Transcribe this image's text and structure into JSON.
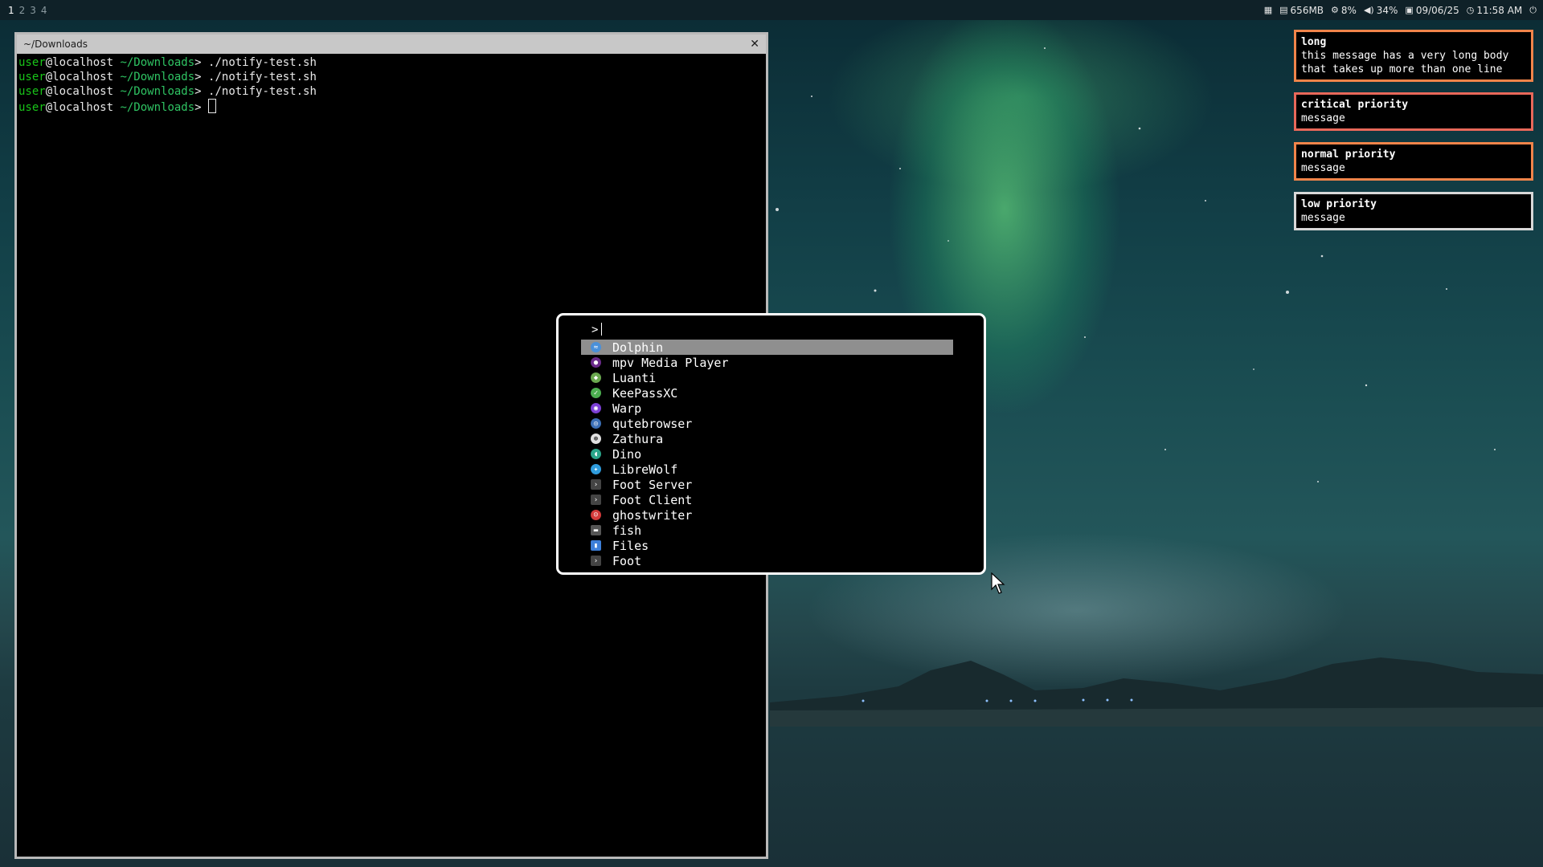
{
  "topbar": {
    "workspaces": [
      "1",
      "2",
      "3",
      "4"
    ],
    "active_workspace": "1",
    "memory": "656MB",
    "cpu": "8%",
    "volume": "34%",
    "date": "09/06/25",
    "time": "11:58 AM"
  },
  "terminal": {
    "title": "~/Downloads",
    "lines": [
      {
        "user": "user",
        "host": "@localhost",
        "path": " ~/Downloads",
        "cmd": "> ./notify-test.sh"
      },
      {
        "user": "user",
        "host": "@localhost",
        "path": " ~/Downloads",
        "cmd": "> ./notify-test.sh"
      },
      {
        "user": "user",
        "host": "@localhost",
        "path": " ~/Downloads",
        "cmd": "> ./notify-test.sh"
      },
      {
        "user": "user",
        "host": "@localhost",
        "path": " ~/Downloads",
        "cmd": "> "
      }
    ]
  },
  "launcher": {
    "prompt": ">",
    "apps": [
      {
        "label": "Dolphin",
        "icon": "dolphin-icon",
        "color": "#4a90d9"
      },
      {
        "label": "mpv Media Player",
        "icon": "mpv-icon",
        "color": "#6a2a8a"
      },
      {
        "label": "Luanti",
        "icon": "luanti-icon",
        "color": "#6aa84f"
      },
      {
        "label": "KeePassXC",
        "icon": "keepassxc-icon",
        "color": "#4caf50"
      },
      {
        "label": "Warp",
        "icon": "warp-icon",
        "color": "#7b3fd4"
      },
      {
        "label": "qutebrowser",
        "icon": "qutebrowser-icon",
        "color": "#3b6fb6"
      },
      {
        "label": "Zathura",
        "icon": "zathura-icon",
        "color": "#e0e0e0"
      },
      {
        "label": "Dino",
        "icon": "dino-icon",
        "color": "#2aa58a"
      },
      {
        "label": "LibreWolf",
        "icon": "librewolf-icon",
        "color": "#2f9cdc"
      },
      {
        "label": "Foot Server",
        "icon": "terminal-icon",
        "color": "#444444"
      },
      {
        "label": "Foot Client",
        "icon": "terminal-icon",
        "color": "#444444"
      },
      {
        "label": "ghostwriter",
        "icon": "ghostwriter-icon",
        "color": "#d33a3a"
      },
      {
        "label": "fish",
        "icon": "fish-icon",
        "color": "#555555"
      },
      {
        "label": "Files",
        "icon": "files-icon",
        "color": "#3d7fd9"
      },
      {
        "label": "Foot",
        "icon": "terminal-icon",
        "color": "#444444"
      }
    ],
    "selected_index": 0
  },
  "notifications": [
    {
      "title": "long",
      "body": "this message has a very long body that takes up more than one line",
      "border": "#f0844a"
    },
    {
      "title": "critical priority",
      "body": "message",
      "border": "#e8685a"
    },
    {
      "title": "normal priority",
      "body": "message",
      "border": "#f0844a"
    },
    {
      "title": "low priority",
      "body": "message",
      "border": "#d8d8d8"
    }
  ]
}
